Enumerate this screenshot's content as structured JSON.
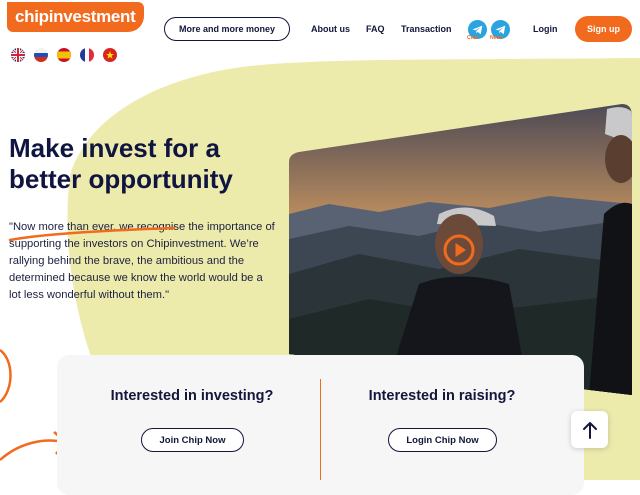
{
  "brand": {
    "logo_text": "chipinvestment",
    "accent_color": "#f16a1d",
    "text_color": "#12163a",
    "blob_color": "#ecebac"
  },
  "languages": [
    {
      "code": "en",
      "icon": "uk-flag-icon"
    },
    {
      "code": "ru",
      "icon": "russia-flag-icon"
    },
    {
      "code": "es",
      "icon": "spain-flag-icon"
    },
    {
      "code": "fr",
      "icon": "france-flag-icon"
    },
    {
      "code": "vi",
      "icon": "vietnam-flag-icon"
    }
  ],
  "nav": {
    "cta_label": "More and more money",
    "about": "About us",
    "faq": "FAQ",
    "transaction": "Transaction",
    "telegram_chat": "Chat",
    "telegram_news": "News",
    "login": "Login",
    "signup": "Sign up"
  },
  "hero": {
    "title": "Make invest for a better opportunity",
    "quote": "\"Now more than ever, we recognise the importance of supporting the investors on Chipinvestment. We’re rallying behind the brave, the ambitious and the determined because we know the world would be a lot less wonderful without them.\"",
    "video_icon": "play-icon"
  },
  "cards": {
    "investing_title": "Interested in investing?",
    "investing_button": "Join Chip Now",
    "raising_title": "Interested in raising?",
    "raising_button": "Login Chip Now"
  },
  "scroll_top_icon": "arrow-up-icon"
}
